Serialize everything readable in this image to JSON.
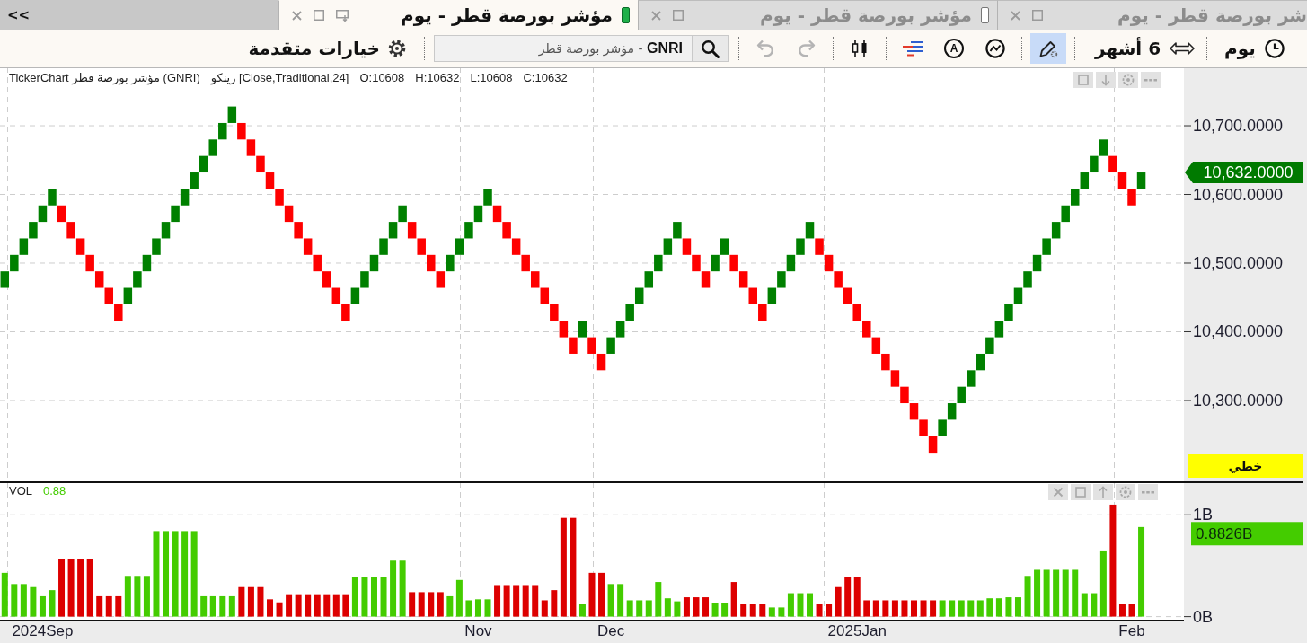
{
  "tab_bar": {
    "scroll_button": "<<",
    "tabs": [
      {
        "label": "شر بورصة قطر - يوم",
        "selected": false
      },
      {
        "label": "مؤشر بورصة قطر - يوم",
        "selected": false,
        "indicator": {
          "filled": false
        }
      },
      {
        "label": "مؤشر بورصة قطر - يوم",
        "selected": true,
        "indicator": {
          "filled": true
        }
      }
    ]
  },
  "toolbar": {
    "options": {
      "label": "خيارات متقدمة"
    },
    "search": {
      "value": "**GNRI** - مؤشر بورصة قطر"
    },
    "history": [
      {
        "kind": "undo",
        "disabled": true
      },
      {
        "kind": "redo",
        "disabled": true
      }
    ],
    "tool_groups": [
      [
        {
          "kind": "candles"
        }
      ],
      [
        {
          "kind": "lines"
        },
        {
          "kind": "letter",
          "label": "A"
        },
        {
          "kind": "trend"
        }
      ]
    ],
    "drawing_tool": {
      "active": true
    },
    "range": {
      "label": "6 أشهر"
    },
    "interval": {
      "label": "يوم"
    }
  },
  "main_chart": {
    "legend": [
      "C:10632",
      "L:10608",
      "H:10632",
      "O:10608",
      "رينكو [Close,Traditional,24]",
      "TickerChart مؤشر بورصة قطر (GNRI)"
    ],
    "last_price": {
      "label": "10,632.0000"
    },
    "scale_button": {
      "label": "خطي"
    },
    "chart_data": {
      "type": "scatter",
      "grid": true,
      "categories": [
        null,
        null,
        null,
        null,
        null,
        null,
        null,
        null,
        null,
        null,
        null,
        null,
        null,
        null,
        null,
        null,
        null,
        null,
        null,
        null,
        null,
        null,
        null,
        null,
        null,
        null,
        null,
        null,
        null,
        null,
        null,
        null,
        null,
        null,
        null,
        null,
        null,
        null,
        null,
        null,
        null,
        null,
        null,
        null,
        null,
        null,
        null,
        null,
        null,
        null,
        null,
        null,
        null,
        null,
        null,
        null,
        null,
        null,
        null,
        null,
        null,
        null,
        null,
        null,
        null,
        null,
        null,
        null,
        null,
        null,
        null,
        null,
        null,
        null,
        null,
        null,
        null,
        null,
        null,
        null,
        null,
        null,
        null,
        null,
        null,
        null,
        null,
        null,
        null,
        null,
        null,
        null,
        null,
        null,
        null,
        null,
        null,
        null,
        null,
        null,
        null,
        null,
        null,
        null,
        null,
        null,
        null,
        null,
        null,
        null,
        null,
        null,
        null,
        null,
        null,
        null,
        null,
        null,
        null,
        null,
        null,
        null,
        null,
        null,
        null
      ],
      "ylim": [
        10181,
        10785
      ],
      "yticks": [
        {
          "value": 10700,
          "label": "10,700.0000"
        },
        {
          "value": 10600,
          "label": "10,600.0000"
        },
        {
          "value": 10500,
          "label": "10,500.0000"
        },
        {
          "value": 10400,
          "label": "10,400.0000"
        },
        {
          "value": 10300,
          "label": "10,300.0000"
        }
      ],
      "series": [
        {
          "color": "#008000",
          "values": [
            10476,
            10500,
            10524,
            10548,
            10572,
            10596,
            null,
            null,
            null,
            null,
            null,
            null,
            null,
            10452,
            10476,
            10500,
            10524,
            10548,
            10572,
            10596,
            10620,
            10644,
            10668,
            10692,
            10716,
            null,
            null,
            null,
            null,
            null,
            null,
            null,
            null,
            null,
            null,
            null,
            null,
            10452,
            10476,
            10500,
            10524,
            10548,
            10572,
            null,
            null,
            null,
            null,
            10500,
            10524,
            10548,
            10572,
            10596,
            null,
            null,
            null,
            null,
            null,
            null,
            null,
            null,
            null,
            10404,
            null,
            null,
            10380,
            10404,
            10428,
            10452,
            10476,
            10500,
            10524,
            10548,
            null,
            null,
            null,
            10500,
            10524,
            null,
            null,
            null,
            null,
            10452,
            10476,
            10500,
            10524,
            10548,
            null,
            null,
            null,
            null,
            null,
            null,
            null,
            null,
            null,
            null,
            null,
            null,
            null,
            10260,
            10284,
            10308,
            10332,
            10356,
            10380,
            10404,
            10428,
            10452,
            10476,
            10500,
            10524,
            10548,
            10572,
            10596,
            10620,
            10644,
            10668,
            null,
            null,
            null,
            10620,
            null,
            null,
            null,
            null
          ]
        },
        {
          "color": "#ff0000",
          "values": [
            null,
            null,
            null,
            null,
            null,
            null,
            10572,
            10548,
            10524,
            10500,
            10476,
            10452,
            10428,
            null,
            null,
            null,
            null,
            null,
            null,
            null,
            null,
            null,
            null,
            null,
            null,
            10692,
            10668,
            10644,
            10620,
            10596,
            10572,
            10548,
            10524,
            10500,
            10476,
            10452,
            10428,
            null,
            null,
            null,
            null,
            null,
            null,
            10548,
            10524,
            10500,
            10476,
            null,
            null,
            null,
            null,
            null,
            10572,
            10548,
            10524,
            10500,
            10476,
            10452,
            10428,
            10404,
            10380,
            null,
            10380,
            10356,
            null,
            null,
            null,
            null,
            null,
            null,
            null,
            null,
            10524,
            10500,
            10476,
            null,
            null,
            10500,
            10476,
            10452,
            10428,
            null,
            null,
            null,
            null,
            null,
            10524,
            10500,
            10476,
            10452,
            10428,
            10404,
            10380,
            10356,
            10332,
            10308,
            10284,
            10260,
            10236,
            null,
            null,
            null,
            null,
            null,
            null,
            null,
            null,
            null,
            null,
            null,
            null,
            null,
            null,
            null,
            null,
            null,
            null,
            10644,
            10620,
            10596,
            null,
            null,
            null,
            null,
            null
          ]
        }
      ]
    }
  },
  "volume_chart": {
    "legend": {
      "label": "VOL",
      "value": "0.88"
    },
    "last_value": {
      "label": "0.8826B"
    },
    "chart_data": {
      "type": "bar",
      "grid": true,
      "categories": [
        null,
        null,
        null,
        null,
        "2024Sep",
        null,
        null,
        null,
        null,
        null,
        null,
        null,
        null,
        null,
        null,
        null,
        null,
        null,
        null,
        null,
        null,
        null,
        null,
        null,
        null,
        null,
        null,
        null,
        null,
        null,
        null,
        null,
        null,
        null,
        null,
        null,
        null,
        null,
        null,
        null,
        null,
        null,
        null,
        null,
        null,
        null,
        null,
        null,
        null,
        null,
        "Nov",
        null,
        null,
        null,
        null,
        null,
        null,
        null,
        null,
        null,
        null,
        null,
        null,
        null,
        "Dec",
        null,
        null,
        null,
        null,
        null,
        null,
        null,
        null,
        null,
        null,
        null,
        null,
        null,
        null,
        null,
        null,
        null,
        null,
        null,
        null,
        null,
        null,
        null,
        null,
        null,
        "2025Jan",
        null,
        null,
        null,
        null,
        null,
        null,
        null,
        null,
        null,
        null,
        null,
        null,
        null,
        null,
        null,
        null,
        null,
        null,
        null,
        null,
        null,
        null,
        null,
        null,
        null,
        null,
        null,
        null,
        "Feb",
        null,
        null,
        null,
        null,
        null
      ],
      "ylim": [
        -0.03,
        1.32
      ],
      "yticks": [
        {
          "value": 1,
          "label": "1B"
        },
        {
          "value": 0,
          "label": "0B"
        }
      ],
      "series": [
        {
          "color": "#44cc00",
          "values": [
            0.43,
            0.32,
            0.32,
            0.29,
            0.2,
            0.26,
            null,
            null,
            null,
            null,
            null,
            null,
            null,
            0.4,
            0.4,
            0.4,
            0.84,
            0.84,
            0.84,
            0.84,
            0.84,
            0.2,
            0.2,
            0.2,
            0.2,
            null,
            null,
            null,
            null,
            null,
            null,
            null,
            null,
            null,
            null,
            null,
            null,
            0.39,
            0.39,
            0.39,
            0.39,
            0.55,
            0.55,
            null,
            null,
            null,
            null,
            0.2,
            0.36,
            0.16,
            0.17,
            0.17,
            null,
            null,
            null,
            null,
            null,
            null,
            null,
            null,
            null,
            0.12,
            null,
            null,
            0.32,
            0.32,
            0.16,
            0.16,
            0.16,
            0.34,
            0.18,
            0.15,
            null,
            null,
            null,
            0.13,
            0.13,
            null,
            null,
            null,
            null,
            0.09,
            0.09,
            0.23,
            0.23,
            0.23,
            null,
            null,
            null,
            null,
            null,
            null,
            null,
            null,
            null,
            null,
            null,
            null,
            null,
            0.16,
            0.16,
            0.16,
            0.16,
            0.16,
            0.18,
            0.18,
            0.19,
            0.19,
            0.4,
            0.46,
            0.46,
            0.46,
            0.46,
            0.46,
            0.23,
            0.23,
            0.65,
            null,
            null,
            null,
            0.88,
            null,
            null,
            null,
            null
          ]
        },
        {
          "color": "#dd0000",
          "values": [
            null,
            null,
            null,
            null,
            null,
            null,
            0.57,
            0.57,
            0.57,
            0.57,
            0.2,
            0.2,
            0.2,
            null,
            null,
            null,
            null,
            null,
            null,
            null,
            null,
            null,
            null,
            null,
            null,
            0.29,
            0.29,
            0.29,
            0.17,
            0.14,
            0.22,
            0.22,
            0.22,
            0.22,
            0.22,
            0.22,
            0.22,
            null,
            null,
            null,
            null,
            null,
            null,
            0.24,
            0.24,
            0.24,
            0.24,
            null,
            null,
            null,
            null,
            null,
            0.31,
            0.31,
            0.31,
            0.31,
            0.31,
            0.16,
            0.26,
            0.97,
            0.97,
            null,
            0.43,
            0.43,
            null,
            null,
            null,
            null,
            null,
            null,
            null,
            null,
            0.19,
            0.19,
            0.19,
            null,
            null,
            0.34,
            0.12,
            0.12,
            0.12,
            null,
            null,
            null,
            null,
            null,
            0.12,
            0.12,
            0.29,
            0.39,
            0.39,
            0.16,
            0.16,
            0.16,
            0.16,
            0.16,
            0.16,
            0.16,
            0.16,
            null,
            null,
            null,
            null,
            null,
            null,
            null,
            null,
            null,
            null,
            null,
            null,
            null,
            null,
            null,
            null,
            null,
            null,
            1.1,
            0.12,
            0.12,
            null,
            null,
            null,
            null,
            null
          ]
        }
      ]
    }
  }
}
